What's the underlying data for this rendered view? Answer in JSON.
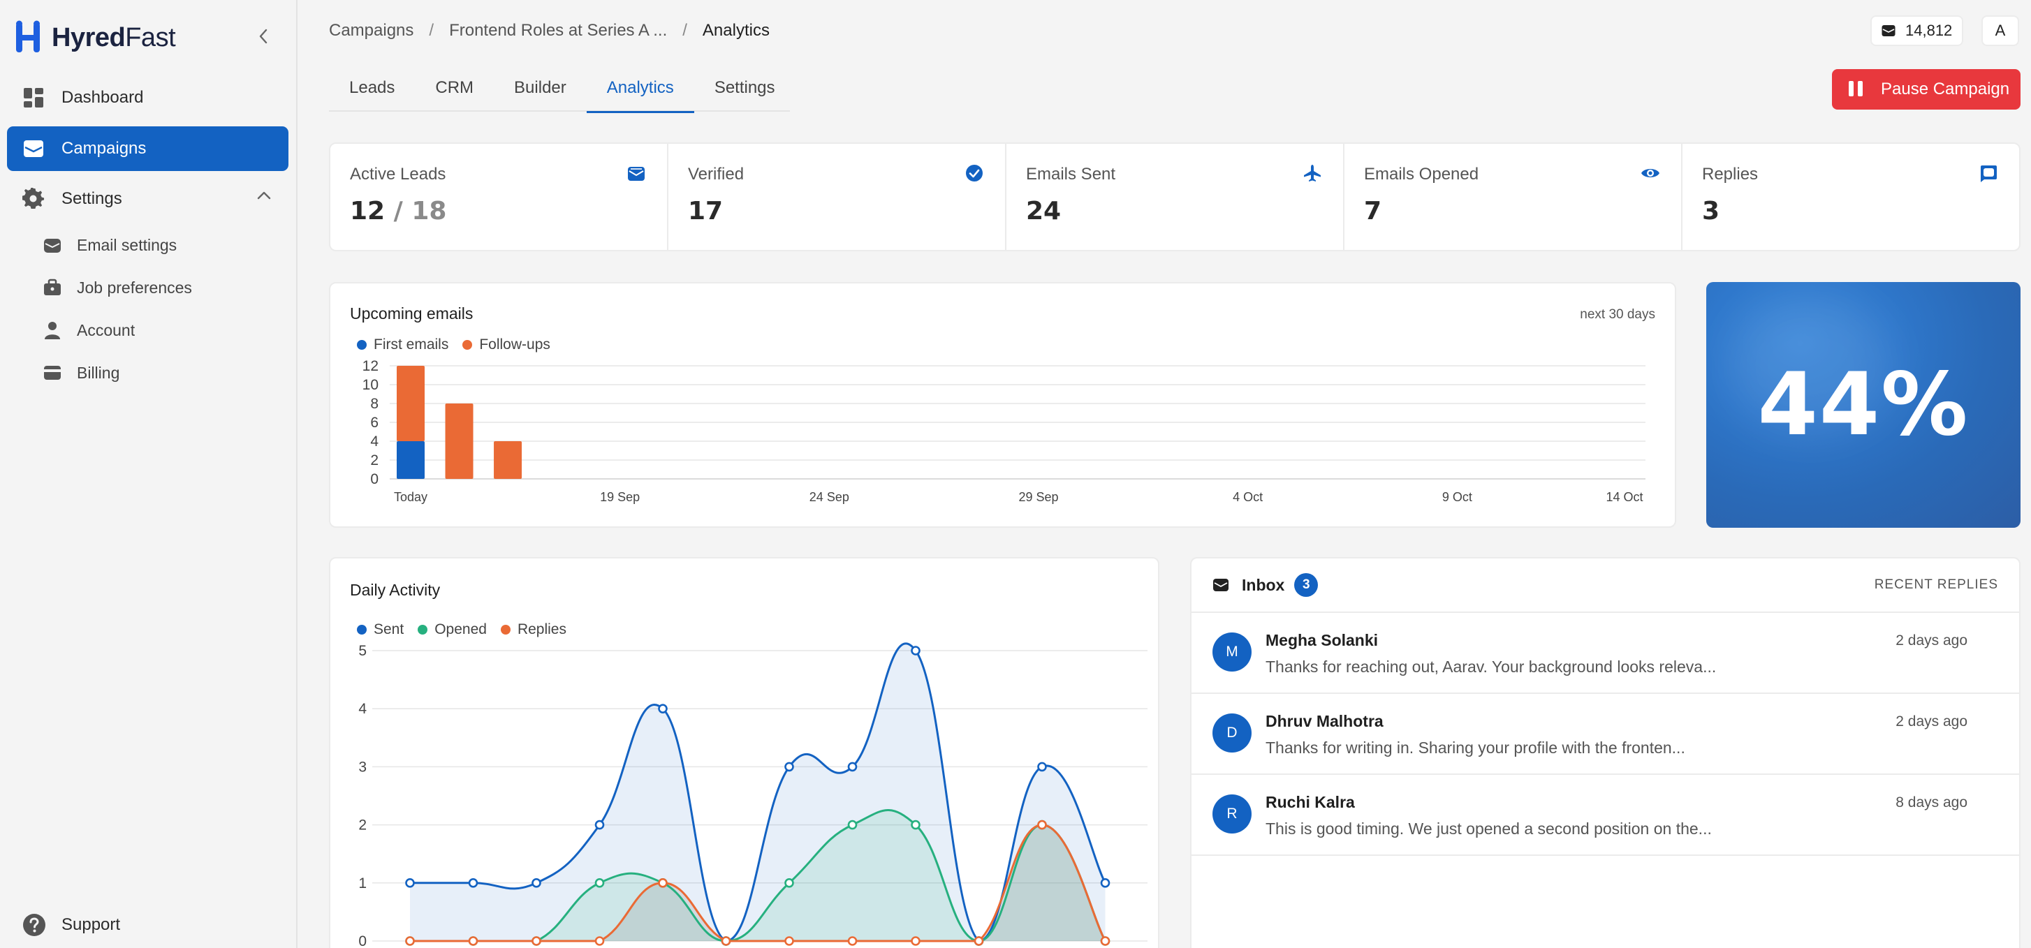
{
  "app": {
    "brand_bold": "Hyred",
    "brand_light": "Fast"
  },
  "sidebar": {
    "items": [
      {
        "label": "Dashboard",
        "icon": "grid-icon"
      },
      {
        "label": "Campaigns",
        "icon": "envelope-icon",
        "active": true
      },
      {
        "label": "Settings",
        "icon": "gear-icon",
        "expanded": true
      }
    ],
    "settings_items": [
      {
        "label": "Email settings",
        "icon": "email-settings-icon"
      },
      {
        "label": "Job preferences",
        "icon": "briefcase-icon"
      },
      {
        "label": "Account",
        "icon": "user-icon"
      },
      {
        "label": "Billing",
        "icon": "credit-card-icon"
      }
    ],
    "support_label": "Support"
  },
  "header": {
    "breadcrumb": [
      "Campaigns",
      "Frontend Roles at Series A ...",
      "Analytics"
    ],
    "credits": "14,812",
    "avatar_letter": "A"
  },
  "tabs": [
    {
      "label": "Leads"
    },
    {
      "label": "CRM"
    },
    {
      "label": "Builder"
    },
    {
      "label": "Analytics",
      "active": true
    },
    {
      "label": "Settings"
    }
  ],
  "pause_button": "Pause Campaign",
  "stats": [
    {
      "label": "Active Leads",
      "value": "12",
      "total": "18",
      "icon": "envelope-open-icon"
    },
    {
      "label": "Verified",
      "value": "17",
      "icon": "check-circle-icon"
    },
    {
      "label": "Emails Sent",
      "value": "24",
      "icon": "plane-icon"
    },
    {
      "label": "Emails Opened",
      "value": "7",
      "icon": "eye-icon"
    },
    {
      "label": "Replies",
      "value": "3",
      "icon": "chat-icon"
    }
  ],
  "percent_card": {
    "value": "44%"
  },
  "colors": {
    "accent": "#1362c2",
    "orange": "#ea6a35",
    "green": "#26b07f",
    "danger": "#e8383d"
  },
  "chart_data": [
    {
      "type": "bar",
      "title": "Upcoming emails",
      "subtitle": "next 30 days",
      "stacked": true,
      "x_ticks": [
        "Today",
        "19 Sep",
        "24 Sep",
        "29 Sep",
        "4 Oct",
        "9 Oct",
        "14 Oct"
      ],
      "x_days": 30,
      "ylim": [
        0,
        12
      ],
      "y_ticks": [
        0,
        2,
        4,
        6,
        8,
        10,
        12
      ],
      "series": [
        {
          "name": "First emails",
          "color": "#1362c2",
          "values": [
            4,
            0,
            0
          ]
        },
        {
          "name": "Follow-ups",
          "color": "#ea6a35",
          "values": [
            8,
            8,
            4
          ]
        }
      ],
      "bar_days": [
        0,
        2,
        4
      ],
      "legend": "top-left",
      "grid": true
    },
    {
      "type": "area",
      "title": "Daily Activity",
      "ylim": [
        0,
        5
      ],
      "y_ticks": [
        0,
        1,
        2,
        3,
        4,
        5
      ],
      "x_count": 12,
      "series": [
        {
          "name": "Sent",
          "color": "#1362c2",
          "values": [
            1,
            1,
            1,
            2,
            4,
            0,
            3,
            3,
            5,
            0,
            3,
            1
          ]
        },
        {
          "name": "Opened",
          "color": "#26b07f",
          "values": [
            0,
            0,
            0,
            1,
            1,
            0,
            1,
            2,
            2,
            0,
            2,
            0
          ]
        },
        {
          "name": "Replies",
          "color": "#ea6a35",
          "values": [
            0,
            0,
            0,
            0,
            1,
            0,
            0,
            0,
            0,
            0,
            2,
            0
          ]
        }
      ],
      "legend": "top-left",
      "grid": true
    }
  ],
  "inbox": {
    "title": "Inbox",
    "count": "3",
    "recent_label": "RECENT REPLIES",
    "messages": [
      {
        "initial": "M",
        "name": "Megha Solanki",
        "time": "2 days ago",
        "preview": "Thanks for reaching out, Aarav. Your background looks releva..."
      },
      {
        "initial": "D",
        "name": "Dhruv Malhotra",
        "time": "2 days ago",
        "preview": "Thanks for writing in. Sharing your profile with the fronten..."
      },
      {
        "initial": "R",
        "name": "Ruchi Kalra",
        "time": "8 days ago",
        "preview": "This is good timing. We just opened a second position on the..."
      }
    ]
  }
}
